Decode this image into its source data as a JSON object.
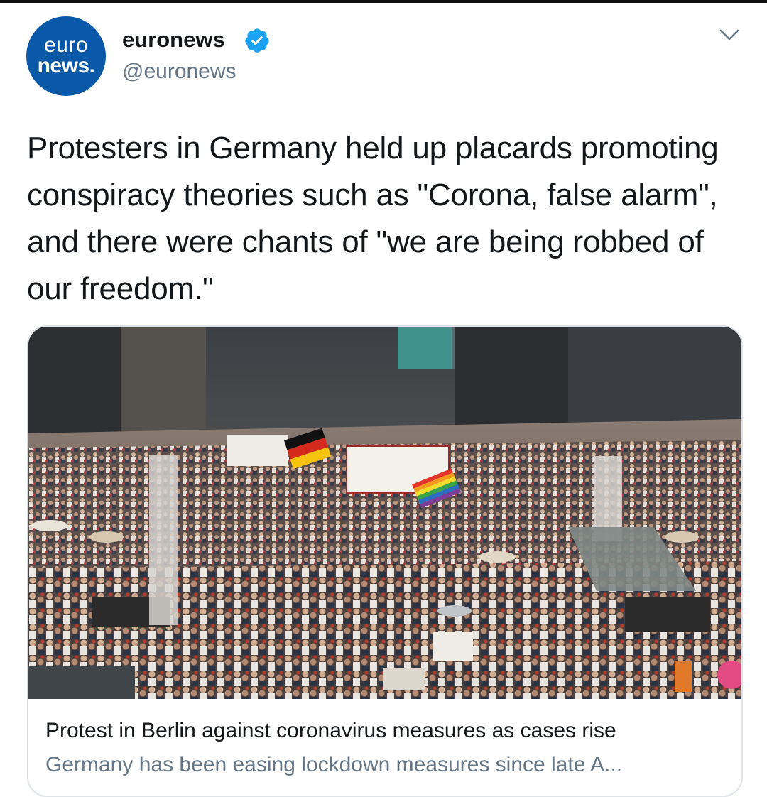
{
  "tweet": {
    "avatar": {
      "line1": "euro",
      "line2": "news."
    },
    "author_name": "euronews",
    "author_handle": "@euronews",
    "text": "Protesters in Germany held up placards promoting conspiracy theories such as \"Corona, false alarm\", and there were chants of \"we are being robbed of our freedom.\"",
    "menu_icon": "chevron-down-icon",
    "verified_icon": "verified-badge-icon"
  },
  "card": {
    "image_alt": "Crowd of protesters marching on a Berlin street holding banners and flags",
    "title": "Protest in Berlin against coronavirus measures as cases rise",
    "description": "Germany has been easing lockdown measures since late A..."
  },
  "colors": {
    "brand_blue": "#0a58a8",
    "verified_blue": "#1da1f2",
    "text_primary": "#14171a",
    "text_secondary": "#657786",
    "card_border": "#dfe4e8"
  }
}
